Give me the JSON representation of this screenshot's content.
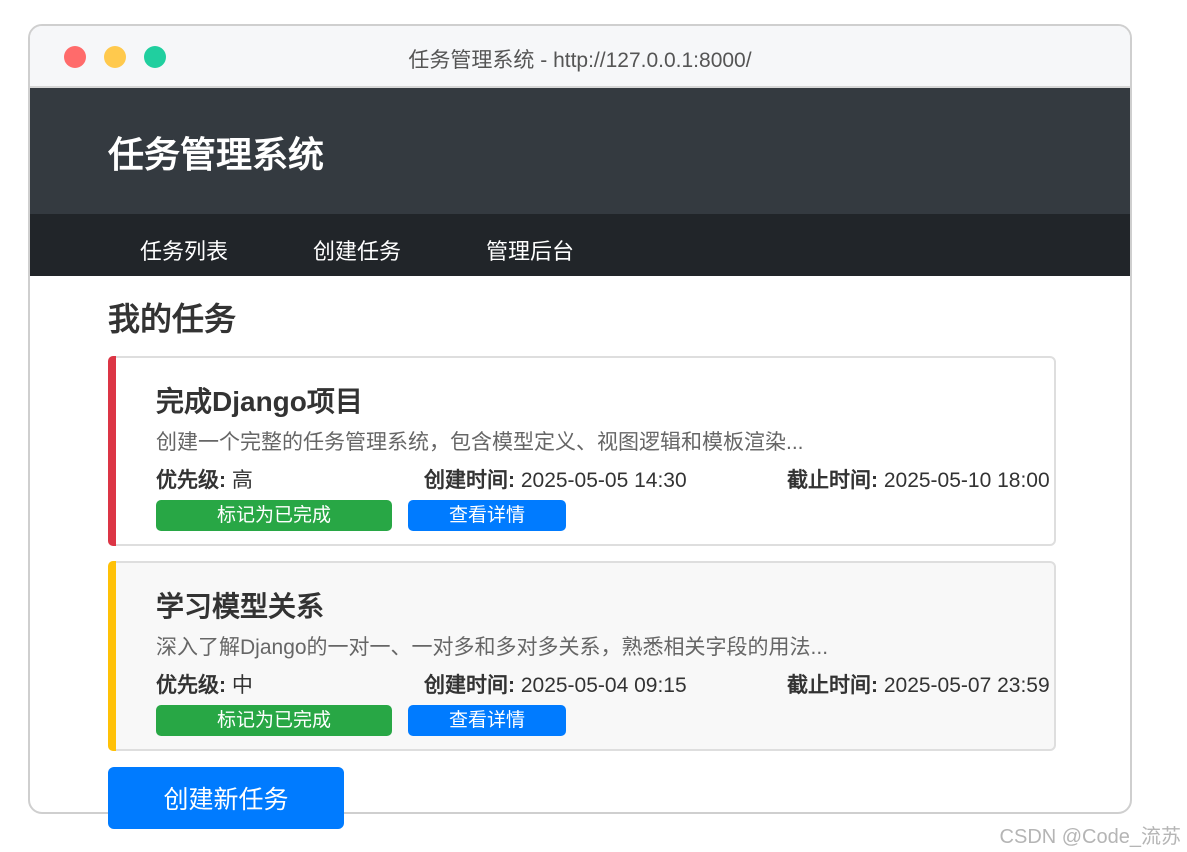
{
  "window": {
    "title": "任务管理系统 - http://127.0.0.1:8000/"
  },
  "header": {
    "app_title": "任务管理系统"
  },
  "nav": {
    "items": [
      "任务列表",
      "创建任务",
      "管理后台"
    ]
  },
  "main": {
    "heading": "我的任务",
    "meta_labels": {
      "priority": "优先级:",
      "created": "创建时间:",
      "due": "截止时间:"
    },
    "tasks": [
      {
        "title": "完成Django项目",
        "description": "创建一个完整的任务管理系统，包含模型定义、视图逻辑和模板渲染...",
        "priority": "高",
        "created_at": "2025-05-05 14:30",
        "due_at": "2025-05-10 18:00",
        "complete_label": "标记为已完成",
        "detail_label": "查看详情",
        "stripe_color": "#dc3545"
      },
      {
        "title": "学习模型关系",
        "description": "深入了解Django的一对一、一对多和多对多关系，熟悉相关字段的用法...",
        "priority": "中",
        "created_at": "2025-05-04 09:15",
        "due_at": "2025-05-07 23:59",
        "complete_label": "标记为已完成",
        "detail_label": "查看详情",
        "stripe_color": "#ffc107"
      }
    ],
    "create_button_label": "创建新任务"
  },
  "watermark": "CSDN @Code_流苏",
  "colors": {
    "header_bg": "#343a40",
    "nav_bg": "#212529",
    "success": "#28a745",
    "primary": "#007bff"
  }
}
